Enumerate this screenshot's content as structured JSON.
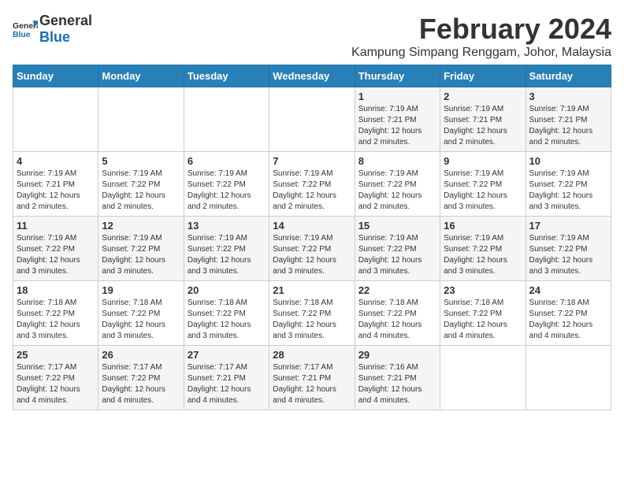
{
  "header": {
    "logo_general": "General",
    "logo_blue": "Blue",
    "month": "February 2024",
    "location": "Kampung Simpang Renggam, Johor, Malaysia"
  },
  "days_of_week": [
    "Sunday",
    "Monday",
    "Tuesday",
    "Wednesday",
    "Thursday",
    "Friday",
    "Saturday"
  ],
  "weeks": [
    [
      {
        "day": "",
        "info": ""
      },
      {
        "day": "",
        "info": ""
      },
      {
        "day": "",
        "info": ""
      },
      {
        "day": "",
        "info": ""
      },
      {
        "day": "1",
        "info": "Sunrise: 7:19 AM\nSunset: 7:21 PM\nDaylight: 12 hours\nand 2 minutes."
      },
      {
        "day": "2",
        "info": "Sunrise: 7:19 AM\nSunset: 7:21 PM\nDaylight: 12 hours\nand 2 minutes."
      },
      {
        "day": "3",
        "info": "Sunrise: 7:19 AM\nSunset: 7:21 PM\nDaylight: 12 hours\nand 2 minutes."
      }
    ],
    [
      {
        "day": "4",
        "info": "Sunrise: 7:19 AM\nSunset: 7:21 PM\nDaylight: 12 hours\nand 2 minutes."
      },
      {
        "day": "5",
        "info": "Sunrise: 7:19 AM\nSunset: 7:22 PM\nDaylight: 12 hours\nand 2 minutes."
      },
      {
        "day": "6",
        "info": "Sunrise: 7:19 AM\nSunset: 7:22 PM\nDaylight: 12 hours\nand 2 minutes."
      },
      {
        "day": "7",
        "info": "Sunrise: 7:19 AM\nSunset: 7:22 PM\nDaylight: 12 hours\nand 2 minutes."
      },
      {
        "day": "8",
        "info": "Sunrise: 7:19 AM\nSunset: 7:22 PM\nDaylight: 12 hours\nand 2 minutes."
      },
      {
        "day": "9",
        "info": "Sunrise: 7:19 AM\nSunset: 7:22 PM\nDaylight: 12 hours\nand 3 minutes."
      },
      {
        "day": "10",
        "info": "Sunrise: 7:19 AM\nSunset: 7:22 PM\nDaylight: 12 hours\nand 3 minutes."
      }
    ],
    [
      {
        "day": "11",
        "info": "Sunrise: 7:19 AM\nSunset: 7:22 PM\nDaylight: 12 hours\nand 3 minutes."
      },
      {
        "day": "12",
        "info": "Sunrise: 7:19 AM\nSunset: 7:22 PM\nDaylight: 12 hours\nand 3 minutes."
      },
      {
        "day": "13",
        "info": "Sunrise: 7:19 AM\nSunset: 7:22 PM\nDaylight: 12 hours\nand 3 minutes."
      },
      {
        "day": "14",
        "info": "Sunrise: 7:19 AM\nSunset: 7:22 PM\nDaylight: 12 hours\nand 3 minutes."
      },
      {
        "day": "15",
        "info": "Sunrise: 7:19 AM\nSunset: 7:22 PM\nDaylight: 12 hours\nand 3 minutes."
      },
      {
        "day": "16",
        "info": "Sunrise: 7:19 AM\nSunset: 7:22 PM\nDaylight: 12 hours\nand 3 minutes."
      },
      {
        "day": "17",
        "info": "Sunrise: 7:19 AM\nSunset: 7:22 PM\nDaylight: 12 hours\nand 3 minutes."
      }
    ],
    [
      {
        "day": "18",
        "info": "Sunrise: 7:18 AM\nSunset: 7:22 PM\nDaylight: 12 hours\nand 3 minutes."
      },
      {
        "day": "19",
        "info": "Sunrise: 7:18 AM\nSunset: 7:22 PM\nDaylight: 12 hours\nand 3 minutes."
      },
      {
        "day": "20",
        "info": "Sunrise: 7:18 AM\nSunset: 7:22 PM\nDaylight: 12 hours\nand 3 minutes."
      },
      {
        "day": "21",
        "info": "Sunrise: 7:18 AM\nSunset: 7:22 PM\nDaylight: 12 hours\nand 3 minutes."
      },
      {
        "day": "22",
        "info": "Sunrise: 7:18 AM\nSunset: 7:22 PM\nDaylight: 12 hours\nand 4 minutes."
      },
      {
        "day": "23",
        "info": "Sunrise: 7:18 AM\nSunset: 7:22 PM\nDaylight: 12 hours\nand 4 minutes."
      },
      {
        "day": "24",
        "info": "Sunrise: 7:18 AM\nSunset: 7:22 PM\nDaylight: 12 hours\nand 4 minutes."
      }
    ],
    [
      {
        "day": "25",
        "info": "Sunrise: 7:17 AM\nSunset: 7:22 PM\nDaylight: 12 hours\nand 4 minutes."
      },
      {
        "day": "26",
        "info": "Sunrise: 7:17 AM\nSunset: 7:22 PM\nDaylight: 12 hours\nand 4 minutes."
      },
      {
        "day": "27",
        "info": "Sunrise: 7:17 AM\nSunset: 7:21 PM\nDaylight: 12 hours\nand 4 minutes."
      },
      {
        "day": "28",
        "info": "Sunrise: 7:17 AM\nSunset: 7:21 PM\nDaylight: 12 hours\nand 4 minutes."
      },
      {
        "day": "29",
        "info": "Sunrise: 7:16 AM\nSunset: 7:21 PM\nDaylight: 12 hours\nand 4 minutes."
      },
      {
        "day": "",
        "info": ""
      },
      {
        "day": "",
        "info": ""
      }
    ]
  ]
}
